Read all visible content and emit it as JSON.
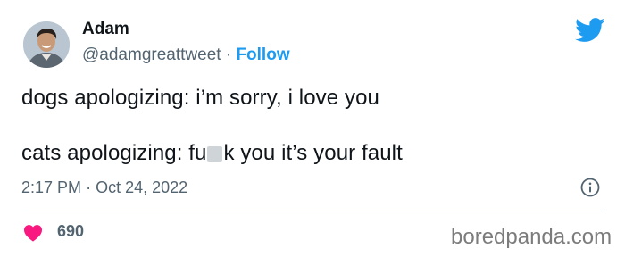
{
  "author": {
    "name": "Adam",
    "handle": "@adamgreattweet",
    "separator": "·",
    "follow_label": "Follow"
  },
  "tweet": {
    "line1": "dogs apologizing: i’m sorry, i love you",
    "line2_before": "cats apologizing: fu",
    "line2_after": "k you it’s your fault"
  },
  "meta": {
    "time": "2:17 PM",
    "separator": "·",
    "date": "Oct 24, 2022"
  },
  "stats": {
    "likes": "690"
  },
  "watermark": "boredpanda.com",
  "icons": {
    "brand": "twitter-bird-icon",
    "info": "info-icon",
    "like": "heart-icon"
  },
  "colors": {
    "accent": "#1d9bf0",
    "heart": "#f91880",
    "text": "#0f1419",
    "muted": "#536471"
  }
}
